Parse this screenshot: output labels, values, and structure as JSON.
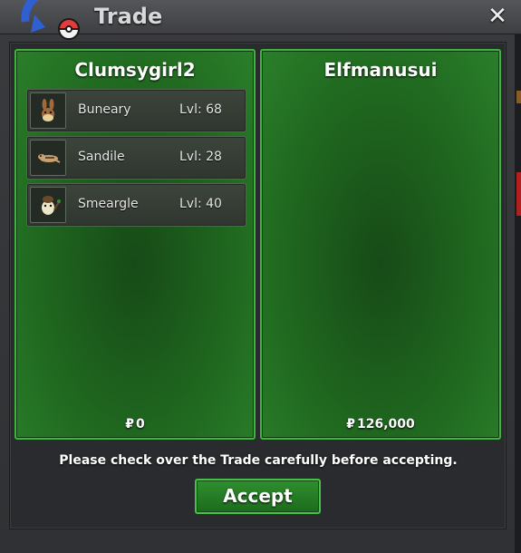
{
  "window": {
    "title": "Trade",
    "close_label": "✕"
  },
  "left_panel": {
    "owner": "Clumsygirl2",
    "money_symbol": "₽",
    "money": "0",
    "items": [
      {
        "name": "Buneary",
        "level": "Lvl: 68",
        "icon": "buneary-sprite-icon"
      },
      {
        "name": "Sandile",
        "level": "Lvl: 28",
        "icon": "sandile-sprite-icon"
      },
      {
        "name": "Smeargle",
        "level": "Lvl: 40",
        "icon": "smeargle-sprite-icon"
      }
    ]
  },
  "right_panel": {
    "owner": "Elfmanusui",
    "money_symbol": "₽",
    "money": "126,000",
    "items": []
  },
  "notice": "Please check over the Trade carefully before accepting.",
  "accept_label": "Accept",
  "colors": {
    "panel_green": "#1f661f",
    "panel_border": "#3fb23f",
    "window_bg": "#303134"
  }
}
